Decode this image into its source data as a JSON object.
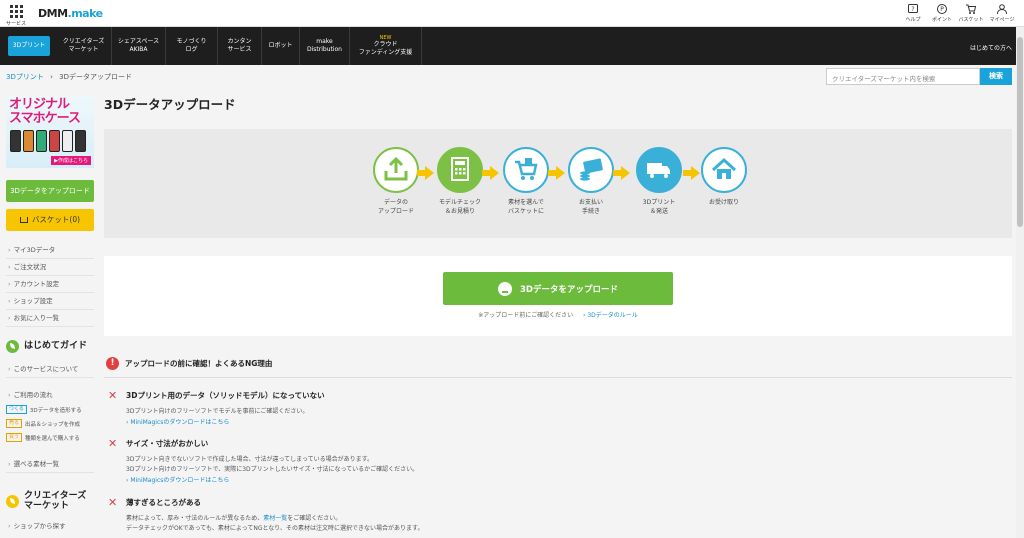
{
  "header": {
    "service_label": "サービス",
    "logo_main": "DMM",
    "logo_sub": ".make",
    "utils": [
      {
        "label": "ヘルプ",
        "icon": "help-icon"
      },
      {
        "label": "ポイント",
        "icon": "point-icon"
      },
      {
        "label": "バスケット",
        "icon": "basket-icon"
      },
      {
        "label": "マイページ",
        "icon": "user-icon"
      }
    ]
  },
  "nav": {
    "items": [
      {
        "line1": "3Dプリント",
        "line2": "",
        "badge": ""
      },
      {
        "line1": "クリエイターズ",
        "line2": "マーケット",
        "badge": ""
      },
      {
        "line1": "シェアスペース",
        "line2": "AKIBA",
        "badge": ""
      },
      {
        "line1": "モノづくり",
        "line2": "ログ",
        "badge": ""
      },
      {
        "line1": "カンタン",
        "line2": "サービス",
        "badge": ""
      },
      {
        "line1": "ロボット",
        "line2": "",
        "badge": ""
      },
      {
        "line1": "make",
        "line2": "Distribution",
        "badge": ""
      },
      {
        "line1": "クラウド",
        "line2": "ファンディング支援",
        "badge": "NEW"
      }
    ],
    "right_link": "はじめての方へ"
  },
  "breadcrumb": {
    "home": "3Dプリント",
    "sep": "›",
    "current": "3Dデータアップロード"
  },
  "search": {
    "placeholder": "クリエイターズマーケット内を検索",
    "button": "検索"
  },
  "sidebar": {
    "banner_title_1": "オリジナル",
    "banner_title_2": "スマホケース",
    "banner_cta": "▶作成はこちら",
    "upload_button": "3Dデータをアップロード",
    "basket_button": "バスケット(0)",
    "account_links": [
      "マイ3Dデータ",
      "ご注文状況",
      "アカウント設定",
      "ショップ設定",
      "お気に入り一覧"
    ],
    "guide_title": "はじめてガイド",
    "guide_links": [
      "このサービスについて",
      "ご利用の流れ"
    ],
    "steps": [
      {
        "tag": "つくる",
        "text": "3Dデータを造形する"
      },
      {
        "tag": "売る",
        "text": "出品＆ショップを作成"
      },
      {
        "tag": "買う",
        "text": "種類を選んで購入する"
      }
    ],
    "material_link": "選べる素材一覧",
    "creators_title_1": "クリエイターズ",
    "creators_title_2": "マーケット",
    "creators_link": "ショップから探す"
  },
  "main": {
    "title": "3Dデータアップロード",
    "flow": [
      {
        "line1": "データの",
        "line2": "アップロード",
        "icon": "upload-icon"
      },
      {
        "line1": "モデルチェック",
        "line2": "＆お見積り",
        "icon": "calculator-icon"
      },
      {
        "line1": "素材を選んで",
        "line2": "バスケットに",
        "icon": "cart-icon"
      },
      {
        "line1": "お支払い",
        "line2": "手続き",
        "icon": "credit-card-icon"
      },
      {
        "line1": "3Dプリント",
        "line2": "＆発送",
        "icon": "truck-icon"
      },
      {
        "line1": "お受け取り",
        "line2": "",
        "icon": "home-icon"
      }
    ],
    "upload_button": "3Dデータをアップロード",
    "upload_note": "※アップロード前にご確認ください",
    "upload_rule_link": "3Dデータのルール",
    "ng_title": "アップロードの前に確認！よくあるNG理由",
    "ng_items": [
      {
        "heading": "3Dプリント用のデータ（ソリッドモデル）になっていない",
        "desc1": "3Dプリント向けのフリーソフトでモデルを事前にご確認ください。",
        "link": "MiniMagicsのダウンロードはこちら"
      },
      {
        "heading": "サイズ・寸法がおかしい",
        "desc1": "3Dプリント向きでないソフトで作成した場合、寸法が違ってしまっている場合があります。",
        "desc2": "3Dプリント向けのフリーソフトで、実際に3Dプリントしたいサイズ・寸法になっているかご確認ください。",
        "link": "MiniMagicsのダウンロードはこちら"
      },
      {
        "heading": "薄すぎるところがある",
        "desc1a": "素材によって、厚み・寸法のルールが異なるため、",
        "desc1link": "素材一覧",
        "desc1b": "をご確認ください。",
        "desc2": "データチェックがOKであっても、素材によってNGとなり、その素材は注文時に選択できない場合があります。"
      }
    ]
  },
  "colors": {
    "accent_blue": "#1aa3d9",
    "green": "#6cbb3c",
    "yellow": "#f6c500",
    "red": "#e04040",
    "nav_bg": "#1e1e1e"
  }
}
